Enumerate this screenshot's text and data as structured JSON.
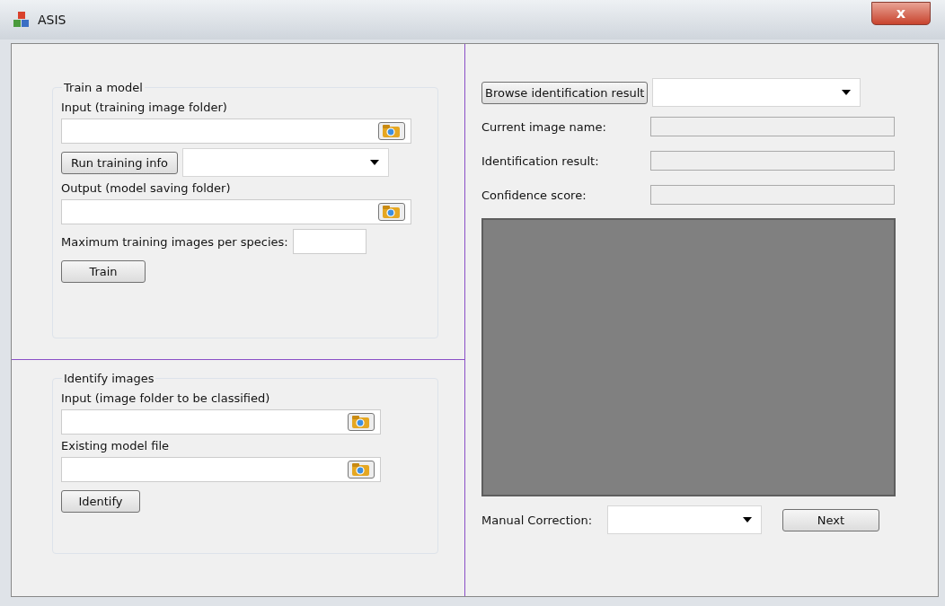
{
  "window": {
    "title": "ASIS",
    "close_label": "x"
  },
  "train": {
    "title": "Train a model",
    "input_label": "Input (training image folder)",
    "run_button": "Run training info",
    "output_label": "Output (model saving folder)",
    "max_label": "Maximum training images per species:",
    "train_button": "Train"
  },
  "identify": {
    "title": "Identify images",
    "input_label": "Input (image folder to be classified)",
    "model_label": "Existing model file",
    "identify_button": "Identify"
  },
  "results": {
    "browse_button": "Browse identification result",
    "fields": [
      {
        "label": "Current image name:"
      },
      {
        "label": "Identification result:"
      },
      {
        "label": "Confidence score:"
      }
    ],
    "correction_label": "Manual Correction:",
    "next_button": "Next"
  }
}
